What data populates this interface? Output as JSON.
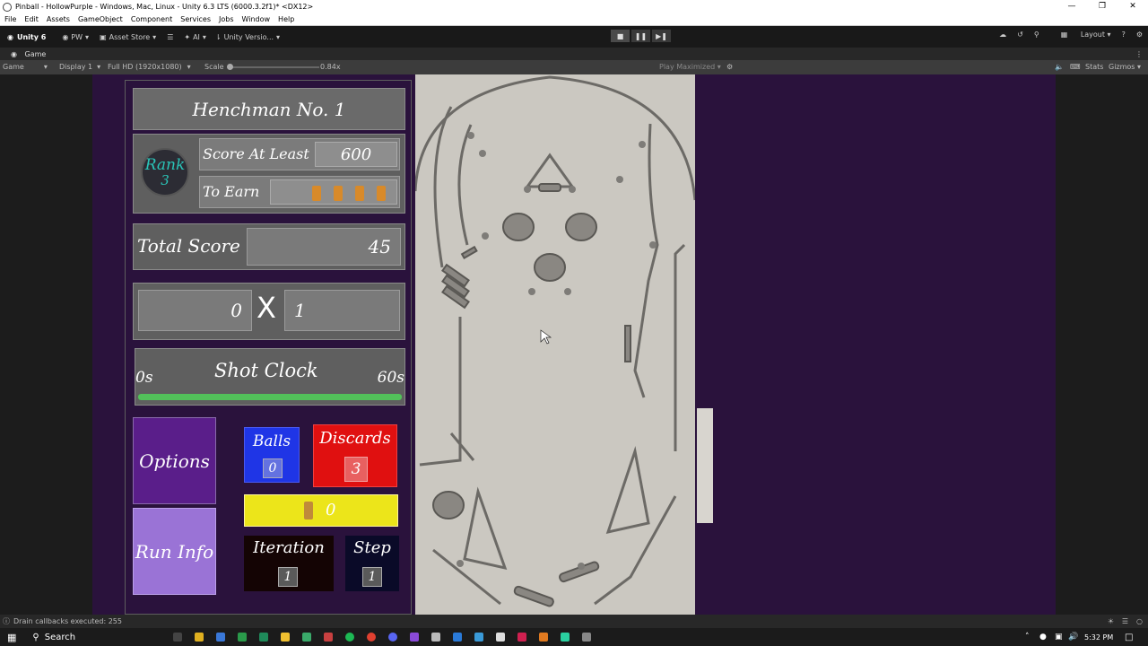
{
  "window": {
    "title": "Pinball - HollowPurple - Windows, Mac, Linux - Unity 6.3 LTS (6000.3.2f1)* <DX12>"
  },
  "menu": [
    "File",
    "Edit",
    "Assets",
    "GameObject",
    "Component",
    "Services",
    "Jobs",
    "Window",
    "Help"
  ],
  "toolbar": {
    "account": "Unity 6",
    "pw": "PW",
    "asset_store": "Asset Store",
    "ai": "AI",
    "version": "Unity Versio...",
    "layout": "Layout"
  },
  "game_tab": {
    "label": "Game"
  },
  "game_bar": {
    "mode": "Game",
    "display": "Display 1",
    "resolution": "Full HD (1920x1080)",
    "scale_label": "Scale",
    "scale_value": "0.84x",
    "play_mode": "Play Maximized",
    "stats": "Stats",
    "gizmos": "Gizmos"
  },
  "hud": {
    "level_title": "Henchman No. 1",
    "rank_label": "Rank",
    "rank_value": "3",
    "score_at_least_label": "Score At Least",
    "score_at_least_value": "600",
    "to_earn_label": "To Earn",
    "total_score_label": "Total Score",
    "total_score_value": "45",
    "multiplier_left": "0",
    "multiplier_sign": "X",
    "multiplier_right": "1",
    "shot_clock_label": "Shot Clock",
    "shot_clock_min": "0s",
    "shot_clock_max": "60s",
    "shot_clock_fill": 1.0,
    "options_label": "Options",
    "run_info_label": "Run Info",
    "balls_label": "Balls",
    "balls_value": "0",
    "discards_label": "Discards",
    "discards_value": "3",
    "yellow_value": "0",
    "iteration_label": "Iteration",
    "iteration_value": "1",
    "step_label": "Step",
    "step_value": "1"
  },
  "status": {
    "message": "Drain callbacks executed: 255"
  },
  "taskbar": {
    "search": "Search",
    "time": "5:32 PM"
  },
  "colors": {
    "purple_bg": "#2a123c",
    "options": "#5a1e8a",
    "run_info": "#9a73d6",
    "balls": "#1f35e6",
    "discards": "#e01010",
    "yellow": "#ece51a",
    "iteration_bg": "#140404",
    "step_bg": "#0a0a28",
    "clock_bar": "#52c15a",
    "rank_text": "#2ac5b8",
    "token": "#d88a2a"
  }
}
